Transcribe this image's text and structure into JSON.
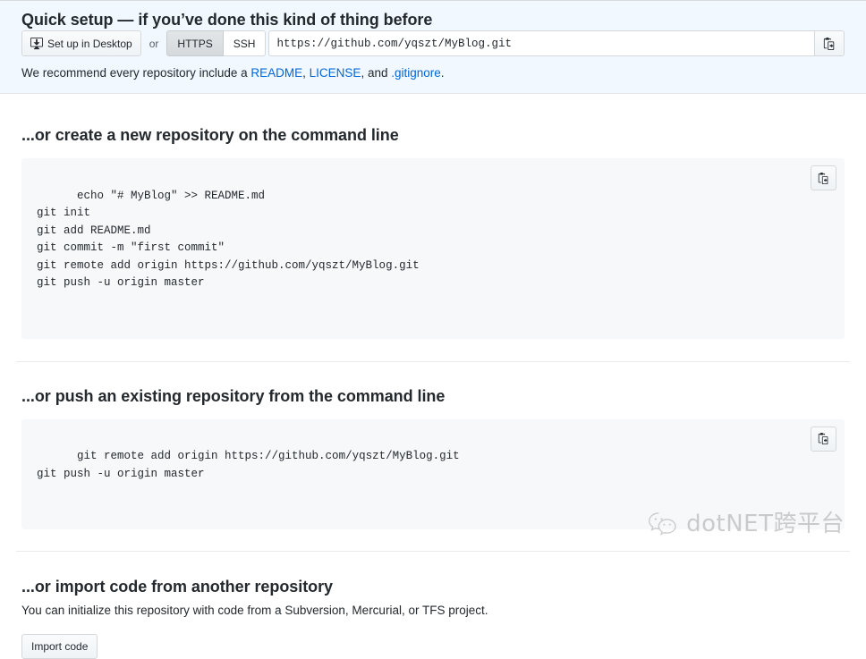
{
  "quick_setup": {
    "title": "Quick setup — if you’ve done this kind of thing before",
    "desktop_button": "Set up in Desktop",
    "or_label": "or",
    "protocols": [
      {
        "label": "HTTPS",
        "selected": true
      },
      {
        "label": "SSH",
        "selected": false
      }
    ],
    "clone_url": "https://github.com/yqszt/MyBlog.git",
    "copy_icon": "clipboard-copy-icon",
    "desktop_icon": "desktop-download-icon",
    "recommend": {
      "prefix": "We recommend every repository include a ",
      "link_readme": "README",
      "sep1": ", ",
      "link_license": "LICENSE",
      "sep2": ", and ",
      "link_gitignore": ".gitignore",
      "suffix": "."
    }
  },
  "create_section": {
    "title": "...or create a new repository on the command line",
    "code": "echo \"# MyBlog\" >> README.md\ngit init\ngit add README.md\ngit commit -m \"first commit\"\ngit remote add origin https://github.com/yqszt/MyBlog.git\ngit push -u origin master",
    "copy_icon": "clipboard-copy-icon"
  },
  "push_section": {
    "title": "...or push an existing repository from the command line",
    "code": "git remote add origin https://github.com/yqszt/MyBlog.git\ngit push -u origin master",
    "copy_icon": "clipboard-copy-icon"
  },
  "import_section": {
    "title": "...or import code from another repository",
    "description": "You can initialize this repository with code from a Subversion, Mercurial, or TFS project.",
    "button": "Import code"
  },
  "watermark": {
    "text": "dotNET跨平台",
    "icon": "wechat-icon"
  },
  "colors": {
    "link": "#0366d6",
    "banner_bg": "#f1f8ff",
    "code_bg": "#f6f8fa",
    "text": "#24292e"
  }
}
